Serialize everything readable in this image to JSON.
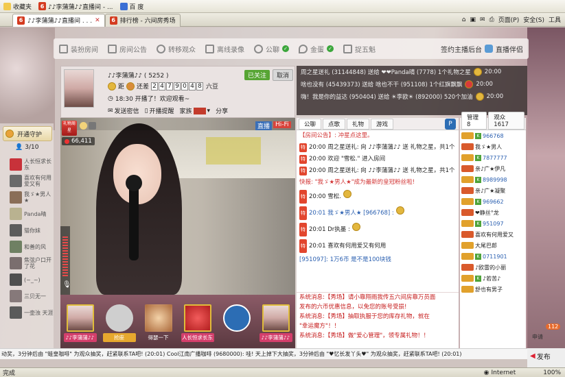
{
  "favbar": {
    "items": [
      "收藏夹",
      "♪♪李蒲蒲♪♪直播间 - ...",
      "百 度"
    ]
  },
  "tabs": [
    {
      "label": "♪♪李蒲蒲♪♪直播间 . . .",
      "active": true
    },
    {
      "label": "排行榜 - 六间房秀场",
      "active": false
    }
  ],
  "browser_tools": {
    "page": "页面(P)",
    "safety": "安全(S)",
    "tools": "工具"
  },
  "nav": {
    "items": [
      "装扮房间",
      "房间公告",
      "转移观众",
      "离线录像",
      "公聊",
      "金蛋",
      "捉五魁"
    ],
    "right1": "签约主播后台",
    "right2": "直播伴侣"
  },
  "host": {
    "name": "♪♪李蒲蒲♪♪ ( 5252 )",
    "follow": "已关注",
    "cancel": "取消",
    "distance_label": "距",
    "still_label": "还差",
    "digits": [
      "2",
      "4",
      "7",
      "9",
      "0",
      "4",
      "8"
    ],
    "unit": "六豆",
    "message": "18:30 开播了！欢迎观看~",
    "send_msg": "发送密信",
    "reminder": "开播提醒",
    "family_label": "家族",
    "share": "分享"
  },
  "video": {
    "live_badge": "直播",
    "hifi_badge": "Hi-Fi",
    "gift_badge": "礼物周星",
    "viewers": "66,411"
  },
  "left": {
    "guard": "开通守护",
    "guard_count": "3/10",
    "users": [
      "人长恒求长东",
      "喜欢有何用爱又有",
      "我ゞ★男人★",
      "Panda晴",
      "猫你妹",
      "和善的风",
      "焦弦户口开了花",
      "(~_~)",
      "三贝无一",
      "一壶浊 天涯"
    ]
  },
  "gifts": {
    "slots": [
      "♪♪李蒲蒲♪♪",
      "抢座",
      "人长恒求长东",
      "♪♪李蒲蒲♪♪"
    ],
    "bottom_label": "得瑟一下"
  },
  "notices": [
    "周之星送礼 (31144848) 送给 ❤❤Panda晴 (7778) 1个礼物之星",
    "啥也没有 (45439373) 送给 啥也不干 (951108) 1个红旗飘飘",
    "嗨！我是你的益达 (950404) 送给 ☀李欧☀ (892000) 520个加油"
  ],
  "notice_times": [
    "20:00",
    "20:00",
    "20:00"
  ],
  "chat": {
    "tabs": [
      "公聊",
      "点歌",
      "礼物",
      "游戏"
    ],
    "announcement": "【房间公告】: 冲星点这里。",
    "lines": [
      {
        "tag": "特",
        "text": "20:00 周之星送礼: 向 ♪♪李蒲蒲♪♪ 送 礼物之星，共1个"
      },
      {
        "tag": "特",
        "text": "20:00 欢迎 \"雪松.\" 进入房间"
      },
      {
        "tag": "特",
        "text": "20:00 周之星送礼: 向 ♪♪李蒲蒲♪♪ 送 礼物之星，共1个"
      },
      {
        "tag": "",
        "text": "快报: \"我ゞ★男人★\"成为最新的皇冠粉丝啦!"
      },
      {
        "tag": "特",
        "text": "20:00 雪松."
      },
      {
        "tag": "特",
        "text": "20:01 我ゞ★男人★ [966768] :"
      },
      {
        "tag": "特",
        "text": "20:01 Dr执墨 :"
      },
      {
        "tag": "特",
        "text": "20:01 喜欢有何用爱又有何用"
      },
      {
        "tag": "",
        "text": "[951097]: 1万6币 是不是100块钱"
      }
    ]
  },
  "system": [
    "系统消息:【秀场】请小靠翔雨我传五六间房靠万员面",
    "发布的六币优惠信息，以免您的账号受损!",
    "系统消息:【秀场】抽取执服于您的库存礼物，就在",
    "\"幸运魔方\"！！",
    "系统消息:【秀场】做\"爱心管理\"，领专属礼物！！"
  ],
  "userlist": {
    "tabs": [
      "管理8",
      "观众1617"
    ],
    "users": [
      "966768",
      "我ゞ★男人",
      "7877777",
      "亲♪广★伊凡",
      "8989998",
      "亲♪广★凝聚",
      "969662",
      "❤静丝°龙",
      "951097",
      "喜欢有何用爱又",
      "大尾巴郎",
      "0711901",
      "♪欧雷的小丽",
      "♪若苦♪",
      "舒也有男子"
    ],
    "badge": "112"
  },
  "ticker": "动奖，3分钟后由 \"蛙皇咖啡\" 为观众抽奖，赶紧联系TA吧! (20:01)  Cool江南广播咖啡 (9680000): 哇! 天上掉下大抽奖，3分钟后由 \"♥忆长发丫头♥\" 为观众抽奖，赶紧联系TA吧! (20:01)",
  "send": {
    "button": "发布",
    "apply": "申请"
  },
  "status": {
    "done": "完成",
    "zone": "Internet",
    "zoom": "100%"
  }
}
